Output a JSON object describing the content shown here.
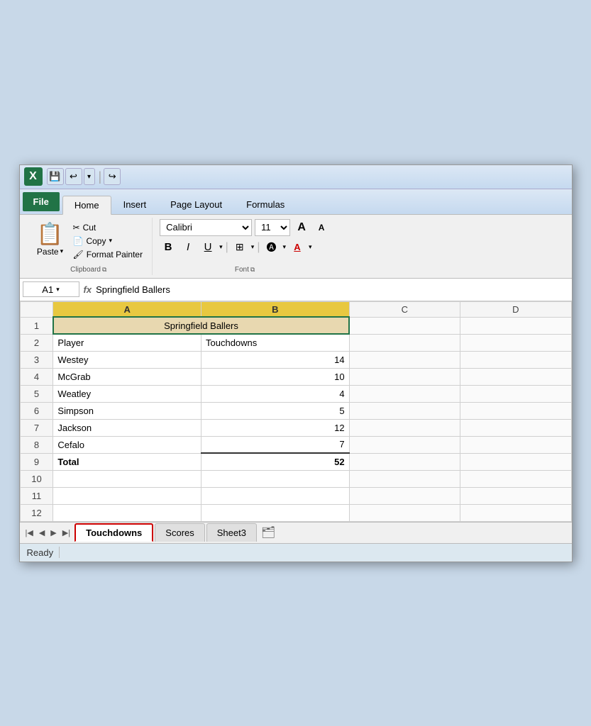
{
  "titlebar": {
    "save_icon": "💾",
    "undo_icon": "↩",
    "redo_icon": "↪",
    "separator": "|"
  },
  "ribbon": {
    "tabs": [
      {
        "label": "File",
        "key": "file",
        "active": false,
        "file": true
      },
      {
        "label": "Home",
        "key": "home",
        "active": true
      },
      {
        "label": "Insert",
        "key": "insert"
      },
      {
        "label": "Page Layout",
        "key": "page-layout"
      },
      {
        "label": "Formulas",
        "key": "formulas"
      }
    ],
    "clipboard": {
      "label": "Clipboard",
      "paste_label": "Paste",
      "cut_label": "Cut",
      "copy_label": "Copy",
      "copy_arrow": "▾",
      "format_painter_label": "Format Painter"
    },
    "font": {
      "label": "Font",
      "family": "Calibri",
      "size": "11",
      "bold": "B",
      "italic": "I",
      "underline": "U",
      "grow": "A",
      "shrink": "A"
    }
  },
  "formulabar": {
    "cell_ref": "A1",
    "fx_label": "fx",
    "value": "Springfield Ballers"
  },
  "sheet": {
    "columns": [
      "",
      "A",
      "B",
      "C",
      "D"
    ],
    "rows": [
      {
        "num": "1",
        "cells": [
          {
            "val": "Springfield Ballers",
            "merged": true,
            "class": "merged"
          },
          {
            "val": "",
            "hidden": true
          },
          {
            "val": "",
            "class": ""
          },
          {
            "val": "",
            "class": ""
          }
        ]
      },
      {
        "num": "2",
        "cells": [
          {
            "val": "Player",
            "class": ""
          },
          {
            "val": "Touchdowns",
            "class": ""
          },
          {
            "val": "",
            "class": ""
          },
          {
            "val": "",
            "class": ""
          }
        ]
      },
      {
        "num": "3",
        "cells": [
          {
            "val": "Westey",
            "class": ""
          },
          {
            "val": "14",
            "class": "text-right"
          },
          {
            "val": "",
            "class": ""
          },
          {
            "val": "",
            "class": ""
          }
        ]
      },
      {
        "num": "4",
        "cells": [
          {
            "val": "McGrab",
            "class": ""
          },
          {
            "val": "10",
            "class": "text-right"
          },
          {
            "val": "",
            "class": ""
          },
          {
            "val": "",
            "class": ""
          }
        ]
      },
      {
        "num": "5",
        "cells": [
          {
            "val": "Weatley",
            "class": ""
          },
          {
            "val": "4",
            "class": "text-right"
          },
          {
            "val": "",
            "class": ""
          },
          {
            "val": "",
            "class": ""
          }
        ]
      },
      {
        "num": "6",
        "cells": [
          {
            "val": "Simpson",
            "class": ""
          },
          {
            "val": "5",
            "class": "text-right"
          },
          {
            "val": "",
            "class": ""
          },
          {
            "val": "",
            "class": ""
          }
        ]
      },
      {
        "num": "7",
        "cells": [
          {
            "val": "Jackson",
            "class": ""
          },
          {
            "val": "12",
            "class": "text-right"
          },
          {
            "val": "",
            "class": ""
          },
          {
            "val": "",
            "class": ""
          }
        ]
      },
      {
        "num": "8",
        "cells": [
          {
            "val": "Cefalo",
            "class": ""
          },
          {
            "val": "7",
            "class": "text-right"
          },
          {
            "val": "",
            "class": ""
          },
          {
            "val": "",
            "class": ""
          }
        ]
      },
      {
        "num": "9",
        "cells": [
          {
            "val": "Total",
            "class": "bold-text"
          },
          {
            "val": "52",
            "class": "text-right bold-text"
          },
          {
            "val": "",
            "class": ""
          },
          {
            "val": "",
            "class": ""
          }
        ]
      },
      {
        "num": "10",
        "cells": [
          {
            "val": "",
            "class": ""
          },
          {
            "val": "",
            "class": ""
          },
          {
            "val": "",
            "class": ""
          },
          {
            "val": "",
            "class": ""
          }
        ]
      },
      {
        "num": "11",
        "cells": [
          {
            "val": "",
            "class": ""
          },
          {
            "val": "",
            "class": ""
          },
          {
            "val": "",
            "class": ""
          },
          {
            "val": "",
            "class": ""
          }
        ]
      },
      {
        "num": "12",
        "cells": [
          {
            "val": "",
            "class": ""
          },
          {
            "val": "",
            "class": ""
          },
          {
            "val": "",
            "class": ""
          },
          {
            "val": "",
            "class": ""
          }
        ]
      }
    ]
  },
  "sheet_tabs": {
    "tabs": [
      {
        "label": "Touchdowns",
        "active": true
      },
      {
        "label": "Scores",
        "active": false
      },
      {
        "label": "Sheet3",
        "active": false
      }
    ],
    "add_icon": "🗂"
  },
  "statusbar": {
    "status": "Ready"
  }
}
